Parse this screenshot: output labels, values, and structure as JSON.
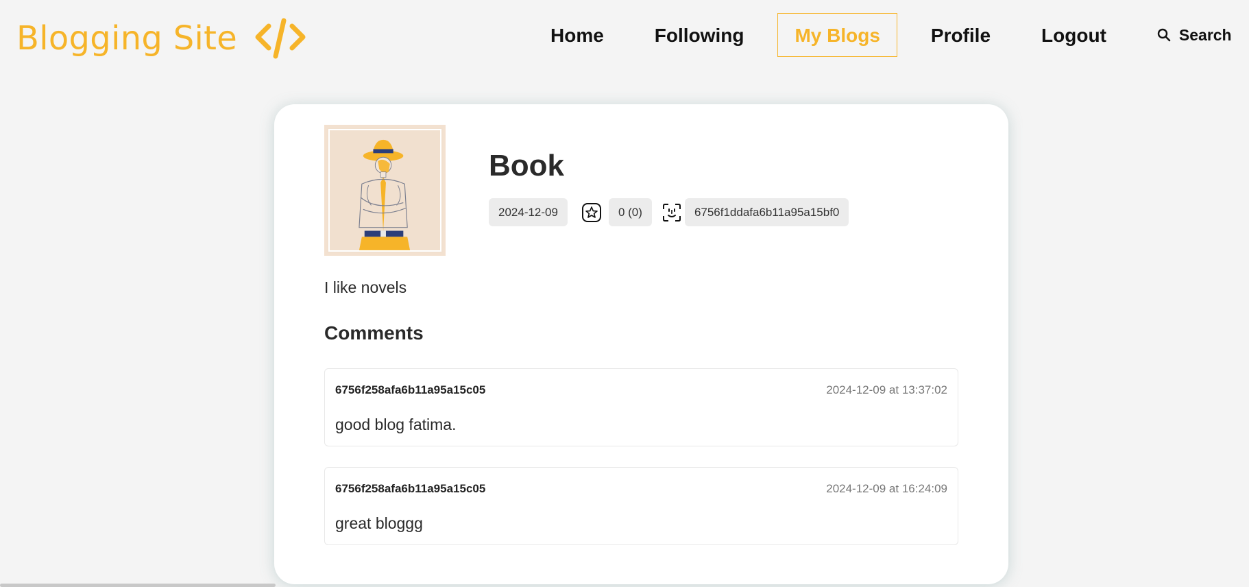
{
  "header": {
    "brand_name": "Blogging Site",
    "brand_icon": "code-brackets-icon",
    "nav": {
      "home": "Home",
      "following": "Following",
      "my_blogs": "My Blogs",
      "profile": "Profile",
      "logout": "Logout",
      "search": "Search"
    },
    "active_nav": "My Blogs"
  },
  "blog": {
    "thumbnail": "man-with-hat-illustration",
    "title": "Book",
    "date": "2024-12-09",
    "rating_icon": "star-icon",
    "rating": "0 (0)",
    "author_icon": "face-scan-icon",
    "author_id": "6756f1ddafa6b11a95a15bf0",
    "description": "I like novels"
  },
  "comments": {
    "heading": "Comments",
    "items": [
      {
        "author": "6756f258afa6b11a95a15c05",
        "timestamp": "2024-12-09 at 13:37:02",
        "text": "good blog fatima."
      },
      {
        "author": "6756f258afa6b11a95a15c05",
        "timestamp": "2024-12-09 at 16:24:09",
        "text": "great bloggg"
      }
    ]
  },
  "colors": {
    "accent": "#f6b429",
    "background": "#f4f4f4",
    "card": "#ffffff",
    "chip": "#ececec"
  }
}
